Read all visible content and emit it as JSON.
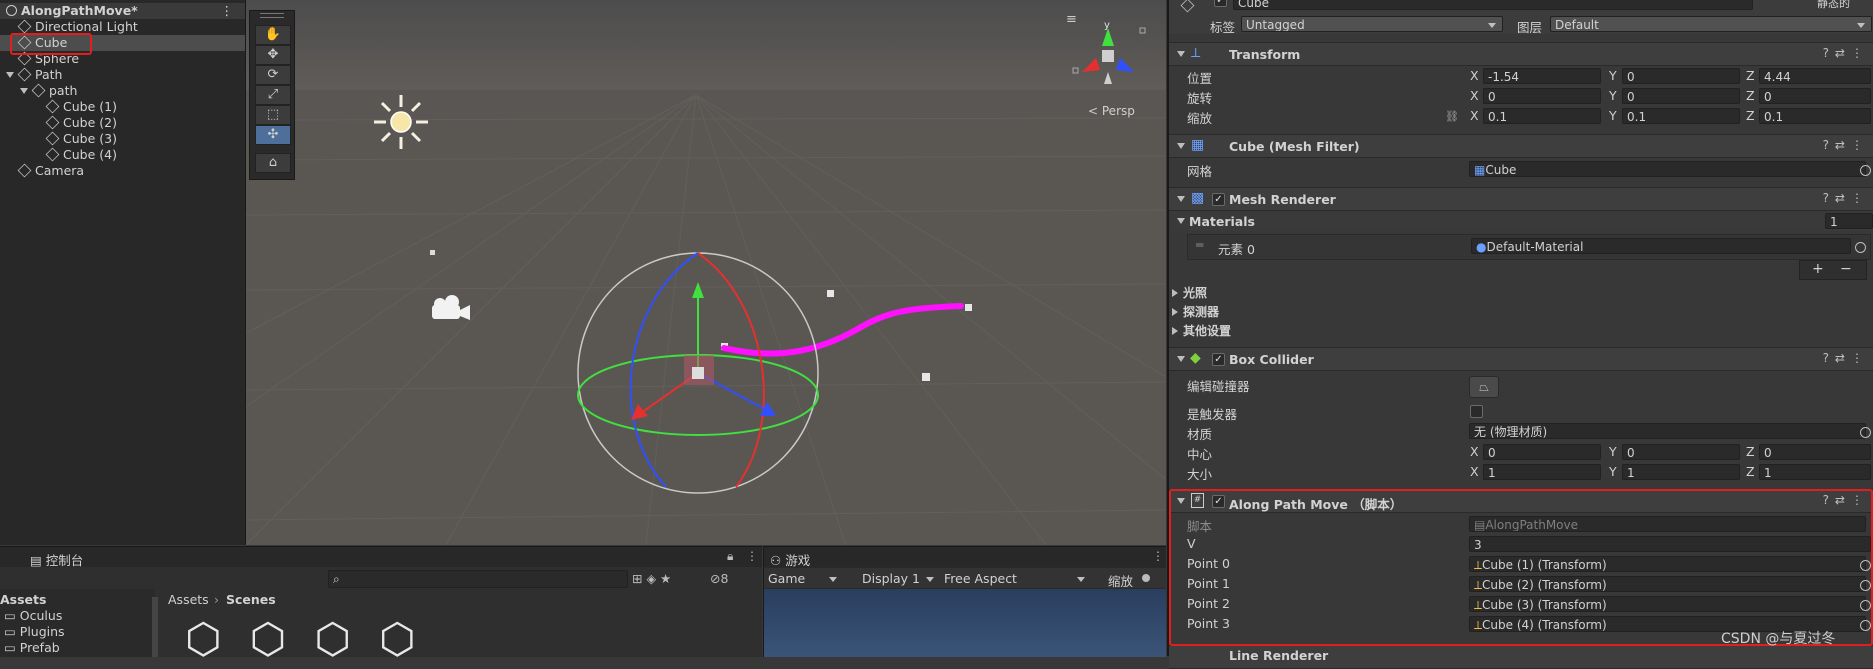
{
  "hierarchy": {
    "scene_name": "AlongPathMove*",
    "items": [
      {
        "label": "Directional Light"
      },
      {
        "label": "Cube"
      },
      {
        "label": "Sphere"
      },
      {
        "label": "Path"
      },
      {
        "label": "path"
      },
      {
        "label": "Cube (1)"
      },
      {
        "label": "Cube (2)"
      },
      {
        "label": "Cube (3)"
      },
      {
        "label": "Cube (4)"
      },
      {
        "label": "Camera"
      }
    ]
  },
  "scene": {
    "persp_label": "Persp",
    "gizmo_y": "y"
  },
  "inspector": {
    "object_name": "Cube",
    "static_label": "静态的",
    "tag_label": "标签",
    "tag_value": "Untagged",
    "layer_label": "图层",
    "layer_value": "Default",
    "transform": {
      "title": "Transform",
      "position_label": "位置",
      "rotation_label": "旋转",
      "scale_label": "缩放",
      "position": {
        "x": "-1.54",
        "y": "0",
        "z": "4.44"
      },
      "rotation": {
        "x": "0",
        "y": "0",
        "z": "0"
      },
      "scale": {
        "x": "0.1",
        "y": "0.1",
        "z": "0.1"
      }
    },
    "axis": {
      "x": "X",
      "y": "Y",
      "z": "Z"
    },
    "mesh_filter": {
      "title": "Cube (Mesh Filter)",
      "mesh_label": "网格",
      "mesh_value": "Cube"
    },
    "mesh_renderer": {
      "title": "Mesh Renderer",
      "materials_label": "Materials",
      "materials_count": "1",
      "element_label": "元素 0",
      "element_value": "Default-Material",
      "lighting_label": "光照",
      "probes_label": "探测器",
      "additional_label": "其他设置",
      "plus": "+",
      "minus": "−"
    },
    "box_collider": {
      "title": "Box Collider",
      "edit_label": "编辑碰撞器",
      "trigger_label": "是触发器",
      "material_label": "材质",
      "material_value": "无 (物理材质)",
      "center_label": "中心",
      "size_label": "大小",
      "center": {
        "x": "0",
        "y": "0",
        "z": "0"
      },
      "size": {
        "x": "1",
        "y": "1",
        "z": "1"
      }
    },
    "along_path": {
      "title": "Along Path Move （脚本）",
      "script_label": "脚本",
      "script_value": "AlongPathMove",
      "v_label": "V",
      "v_value": "3",
      "points": [
        {
          "label": "Point 0",
          "value": "Cube (1) (Transform)"
        },
        {
          "label": "Point 1",
          "value": "Cube (2) (Transform)"
        },
        {
          "label": "Point 2",
          "value": "Cube (3) (Transform)"
        },
        {
          "label": "Point 3",
          "value": "Cube (4) (Transform)"
        }
      ]
    },
    "line_renderer_title": "Line Renderer"
  },
  "project": {
    "console_tab": "控制台",
    "search_count": "8",
    "assets_root": "Assets",
    "folders": [
      "Oculus",
      "Plugins",
      "Prefab"
    ],
    "breadcrumb_root": "Assets",
    "breadcrumb_current": "Scenes"
  },
  "game": {
    "tab": "游戏",
    "mode": "Game",
    "display": "Display 1",
    "aspect": "Free Aspect",
    "scale_label": "缩放"
  },
  "watermark": "CSDN @与夏过冬",
  "colors": {
    "selection_red": "#e02020",
    "path_magenta": "#ff10ff",
    "axis_red": "#e63030",
    "axis_green": "#40e040",
    "axis_blue": "#3050ff"
  }
}
